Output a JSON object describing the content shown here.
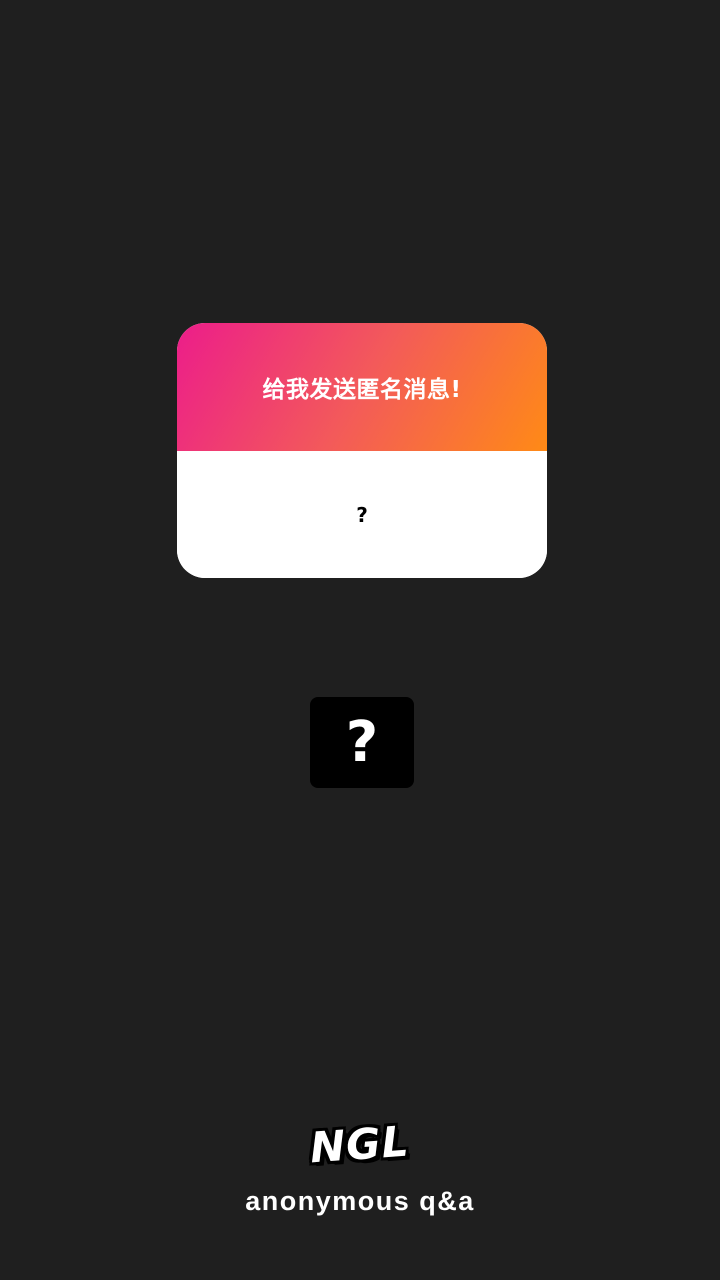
{
  "card": {
    "header_text": "给我发送匿名消息!",
    "body_text": "?"
  },
  "question_box": {
    "icon": "question-mark-icon",
    "symbol": "?"
  },
  "brand": {
    "logo_text": "NGL",
    "tagline": "anonymous q&a"
  },
  "colors": {
    "background": "#1f1f1f",
    "gradient_start": "#ec1d8a",
    "gradient_end": "#ff8a16",
    "card_body": "#ffffff",
    "question_box": "#000000"
  }
}
